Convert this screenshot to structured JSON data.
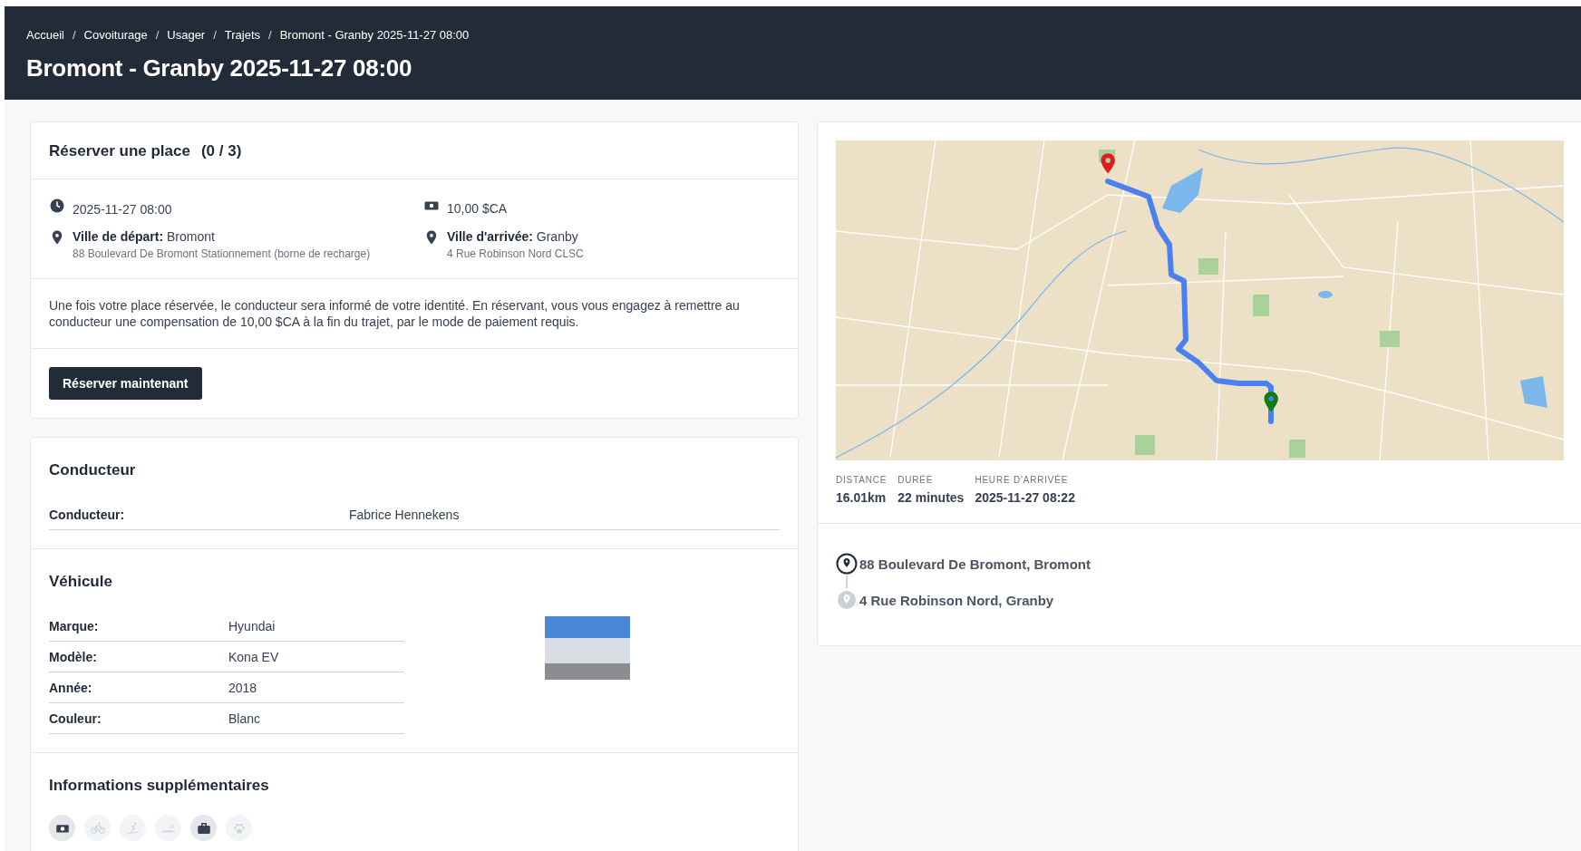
{
  "breadcrumb": [
    {
      "label": "Accueil"
    },
    {
      "label": "Covoiturage"
    },
    {
      "label": "Usager"
    },
    {
      "label": "Trajets"
    },
    {
      "label": "Bromont - Granby 2025-11-27 08:00"
    }
  ],
  "separator": "/",
  "page_title": "Bromont - Granby 2025-11-27 08:00",
  "booking": {
    "title": "Réserver une place",
    "seats": "(0 / 3)",
    "datetime": "2025-11-27 08:00",
    "price": "10,00 $CA",
    "departure": {
      "label": "Ville de départ:",
      "city": "Bromont",
      "address": "88 Boulevard De Bromont Stationnement (borne de recharge)"
    },
    "arrival": {
      "label": "Ville d'arrivée:",
      "city": "Granby",
      "address": "4 Rue Robinson Nord CLSC"
    },
    "notice": "Une fois votre place réservée, le conducteur sera informé de votre identité. En réservant, vous vous engagez à remettre au conducteur une compensation de 10,00 $CA à la fin du trajet, par le mode de paiement requis.",
    "button": "Réserver maintenant"
  },
  "driver": {
    "title": "Conducteur",
    "rows": [
      {
        "label": "Conducteur:",
        "value": "Fabrice Hennekens"
      }
    ]
  },
  "vehicle": {
    "title": "Véhicule",
    "rows": [
      {
        "label": "Marque:",
        "value": "Hyundai"
      },
      {
        "label": "Modèle:",
        "value": "Kona EV"
      },
      {
        "label": "Année:",
        "value": "2018"
      },
      {
        "label": "Couleur:",
        "value": "Blanc"
      }
    ]
  },
  "extra": {
    "title": "Informations supplémentaires",
    "amenities": [
      {
        "kind": "cash",
        "on": true
      },
      {
        "kind": "bike",
        "on": false
      },
      {
        "kind": "ski",
        "on": false
      },
      {
        "kind": "smoking",
        "on": false
      },
      {
        "kind": "luggage",
        "on": true
      },
      {
        "kind": "pet",
        "on": false
      }
    ]
  },
  "trip_stats": [
    {
      "label": "DISTANCE",
      "value": "16.01km"
    },
    {
      "label": "DURÉE",
      "value": "22 minutes"
    },
    {
      "label": "HEURE D'ARRIVÉE",
      "value": "2025-11-27 08:22"
    }
  ],
  "stops": [
    {
      "kind": "origin",
      "address": "88 Boulevard De Bromont, Bromont"
    },
    {
      "kind": "destination",
      "address": "4 Rue Robinson Nord, Granby"
    }
  ]
}
